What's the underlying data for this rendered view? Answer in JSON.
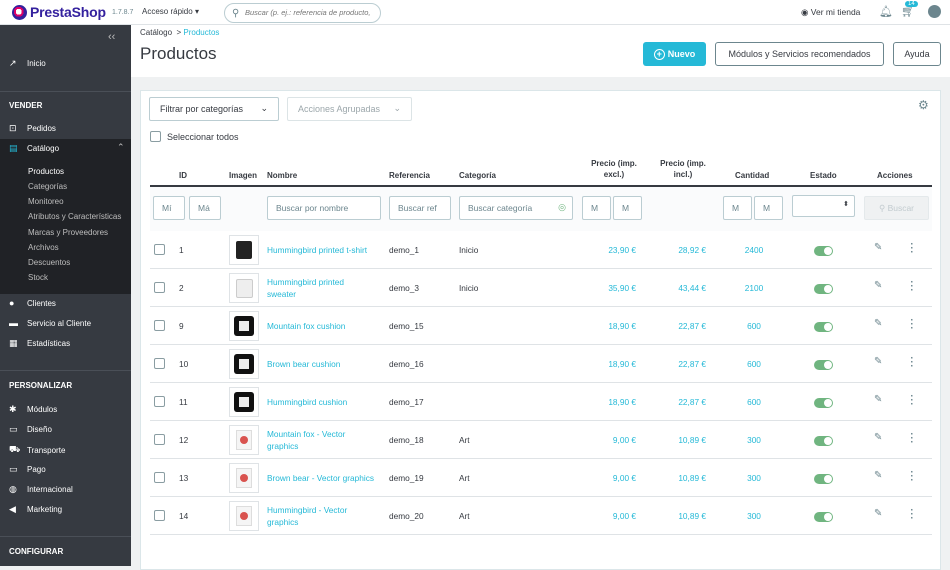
{
  "topbar": {
    "logo": "PrestaShop",
    "version": "1.7.8.7",
    "quick_access": "Acceso rápido",
    "search_placeholder": "Buscar (p. ej.: referencia de producto,",
    "view_shop": "Ver mi tienda",
    "cart_badge": "14"
  },
  "sidebar": {
    "inicio": "Inicio",
    "vender": "VENDER",
    "pedidos": "Pedidos",
    "catalogo": "Catálogo",
    "sub": [
      "Productos",
      "Categorías",
      "Monitoreo",
      "Atributos y Características",
      "Marcas y Proveedores",
      "Archivos",
      "Descuentos",
      "Stock"
    ],
    "clientes": "Clientes",
    "servicio": "Servicio al Cliente",
    "estadisticas": "Estadísticas",
    "personalizar": "PERSONALIZAR",
    "modulos": "Módulos",
    "diseno": "Diseño",
    "transporte": "Transporte",
    "pago": "Pago",
    "internacional": "Internacional",
    "marketing": "Marketing",
    "configurar": "CONFIGURAR"
  },
  "header": {
    "breadcrumb_parent": "Catálogo",
    "breadcrumb_sep": ">",
    "breadcrumb_current": "Productos",
    "title": "Productos",
    "btn_new": "Nuevo",
    "btn_modules": "Módulos y Servicios recomendados",
    "btn_help": "Ayuda"
  },
  "panel": {
    "filter_categories": "Filtrar por categorías",
    "bulk_actions": "Acciones Agrupadas",
    "select_all": "Seleccionar todos",
    "columns": {
      "id": "ID",
      "image": "Imagen",
      "name": "Nombre",
      "reference": "Referencia",
      "category": "Categoría",
      "price_excl_1": "Precio (imp.",
      "price_excl_2": "excl.)",
      "price_incl_1": "Precio (imp.",
      "price_incl_2": "incl.)",
      "quantity": "Cantidad",
      "status": "Estado",
      "actions": "Acciones"
    },
    "filters": {
      "id_min": "Mí",
      "id_max": "Má",
      "name": "Buscar por nombre",
      "reference": "Buscar ref",
      "category": "Buscar categoría",
      "price_min": "M",
      "price_max": "M",
      "qty_min": "M",
      "qty_max": "M",
      "search_btn": "Buscar"
    }
  },
  "products": [
    {
      "id": "1",
      "name1": "Hummingbird printed t-shirt",
      "name2": "",
      "ref": "demo_1",
      "cat": "Inicio",
      "pe": "23,90 €",
      "pi": "28,92 €",
      "qty": "2400",
      "active": true,
      "thumb": "tshirt-icon"
    },
    {
      "id": "2",
      "name1": "Hummingbird printed",
      "name2": "sweater",
      "ref": "demo_3",
      "cat": "Inicio",
      "pe": "35,90 €",
      "pi": "43,44 €",
      "qty": "2100",
      "active": true,
      "thumb": "sweater-icon"
    },
    {
      "id": "9",
      "name1": "Mountain fox cushion",
      "name2": "",
      "ref": "demo_15",
      "cat": "",
      "pe": "18,90 €",
      "pi": "22,87 €",
      "qty": "600",
      "active": true,
      "thumb": "cushion-icon"
    },
    {
      "id": "10",
      "name1": "Brown bear cushion",
      "name2": "",
      "ref": "demo_16",
      "cat": "",
      "pe": "18,90 €",
      "pi": "22,87 €",
      "qty": "600",
      "active": true,
      "thumb": "cushion-icon"
    },
    {
      "id": "11",
      "name1": "Hummingbird cushion",
      "name2": "",
      "ref": "demo_17",
      "cat": "",
      "pe": "18,90 €",
      "pi": "22,87 €",
      "qty": "600",
      "active": true,
      "thumb": "cushion-icon"
    },
    {
      "id": "12",
      "name1": "Mountain fox - Vector",
      "name2": "graphics",
      "ref": "demo_18",
      "cat": "Art",
      "pe": "9,00 €",
      "pi": "10,89 €",
      "qty": "300",
      "active": true,
      "thumb": "vector-art-icon"
    },
    {
      "id": "13",
      "name1": "Brown bear - Vector graphics",
      "name2": "",
      "ref": "demo_19",
      "cat": "Art",
      "pe": "9,00 €",
      "pi": "10,89 €",
      "qty": "300",
      "active": true,
      "thumb": "vector-art-icon"
    },
    {
      "id": "14",
      "name1": "Hummingbird - Vector",
      "name2": "graphics",
      "ref": "demo_20",
      "cat": "Art",
      "pe": "9,00 €",
      "pi": "10,89 €",
      "qty": "300",
      "active": true,
      "thumb": "vector-art-icon"
    }
  ]
}
